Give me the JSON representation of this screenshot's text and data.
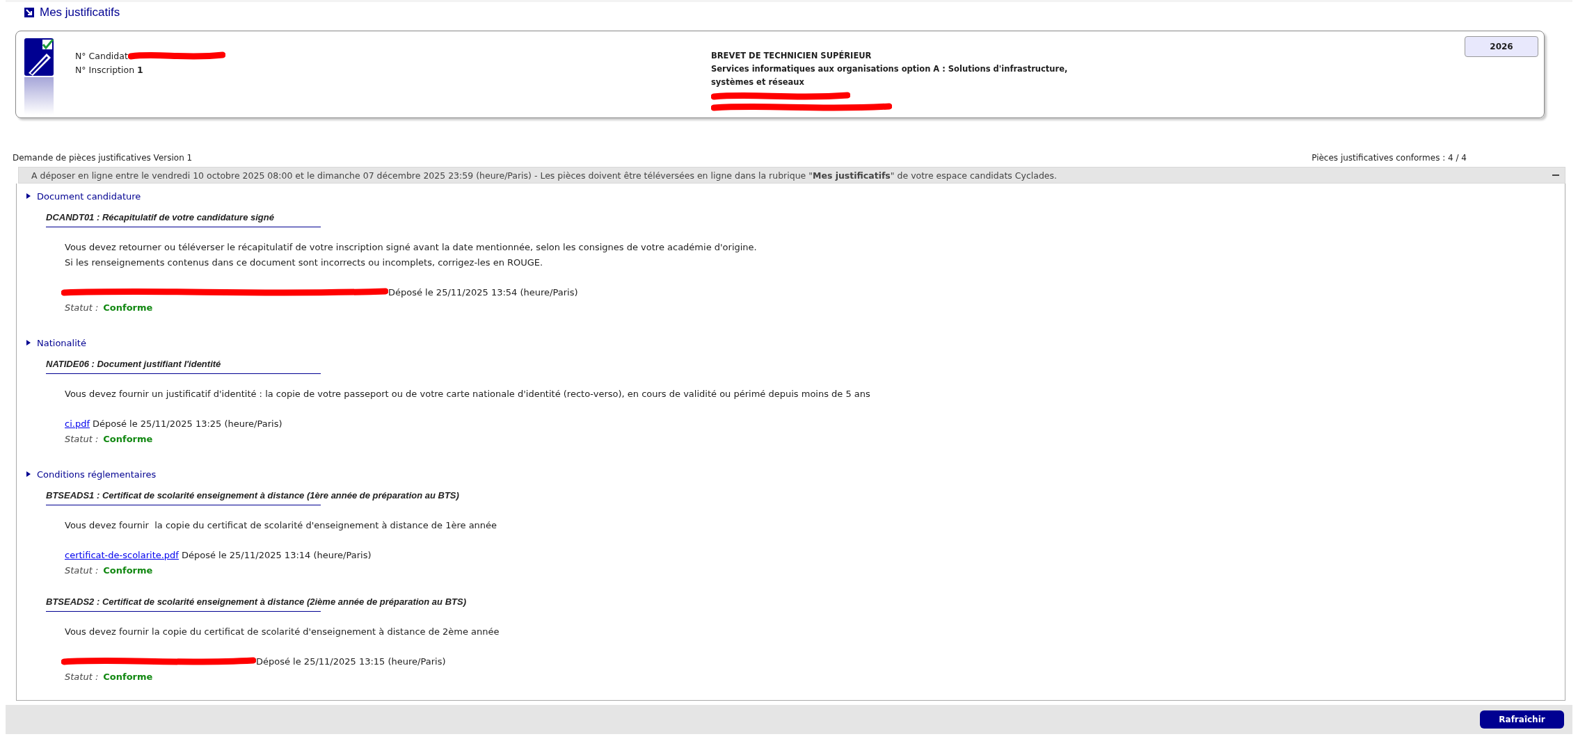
{
  "page_title": "Mes justificatifs",
  "candidate_card": {
    "candidate_label": "N° Candidat",
    "candidate_number_redacted": true,
    "inscription_label": "N° Inscription",
    "inscription_number": "1",
    "exam": "BREVET DE TECHNICIEN SUPÉRIEUR",
    "specialty_lines": [
      "Services informatiques aux organisations option A : Solutions d'infrastructure,",
      "systèmes et réseaux"
    ],
    "details_redacted": true,
    "year": "2026"
  },
  "request": {
    "title": "Demande de pièces justificatives Version 1",
    "compliance": "Pièces justificatives conformes : 4 / 4"
  },
  "deadline_bar": {
    "text": "A déposer en ligne entre le vendredi 10 octobre 2025 08:00 et le dimanche 07 décembre 2025 23:59 (heure/Paris) - Les pièces doivent être téléversées en ligne dans la rubrique \"**Mes justificatifs**\" de votre espace candidats Cyclades.",
    "expanded": true
  },
  "sections": [
    {
      "heading": "Document candidature",
      "items": [
        {
          "title": "DCANDT01 : Récapitulatif de votre candidature signé",
          "description": [
            "Vous devez retourner ou téléverser le récapitulatif de votre inscription signé avant la date mentionnée, selon les consignes de votre académie d'origine.",
            "Si les renseignements contenus dans ce document sont incorrects ou incomplets, corrigez-les en ROUGE."
          ],
          "file": {
            "redacted": true
          },
          "deposit": "Déposé le 25/11/2025 13:54 (heure/Paris)",
          "status_label": "Statut :",
          "status": "Conforme"
        }
      ]
    },
    {
      "heading": "Nationalité",
      "items": [
        {
          "title": "NATIDE06 : Document justifiant l'identité",
          "description": [
            "Vous devez fournir un justificatif d'identité : la copie de votre passeport ou de votre carte nationale d'identité (recto-verso), en cours de validité ou périmé depuis moins de 5 ans"
          ],
          "file": {
            "redacted": false,
            "name": "ci.pdf"
          },
          "deposit": "Déposé le 25/11/2025 13:25 (heure/Paris)",
          "status_label": "Statut :",
          "status": "Conforme"
        }
      ]
    },
    {
      "heading": "Conditions réglementaires",
      "items": [
        {
          "title": "BTSEADS1 : Certificat de scolarité enseignement à distance (1ère année de préparation au BTS)",
          "description": [
            "Vous devez fournir  la copie du certificat de scolarité d'enseignement à distance de 1ère année"
          ],
          "file": {
            "redacted": false,
            "name": "certificat-de-scolarite.pdf"
          },
          "deposit": "Déposé le 25/11/2025 13:14 (heure/Paris)",
          "status_label": "Statut :",
          "status": "Conforme"
        },
        {
          "title": "BTSEADS2 : Certificat de scolarité enseignement à distance (2ième année de préparation au BTS)",
          "description": [
            "Vous devez fournir la copie du certificat de scolarité d'enseignement à distance de 2ème année"
          ],
          "file": {
            "redacted": true
          },
          "deposit": "Déposé le 25/11/2025 13:15 (heure/Paris)",
          "status_label": "Statut :",
          "status": "Conforme"
        }
      ]
    }
  ],
  "buttons": [
    {
      "label": "Rafraîchir"
    }
  ]
}
